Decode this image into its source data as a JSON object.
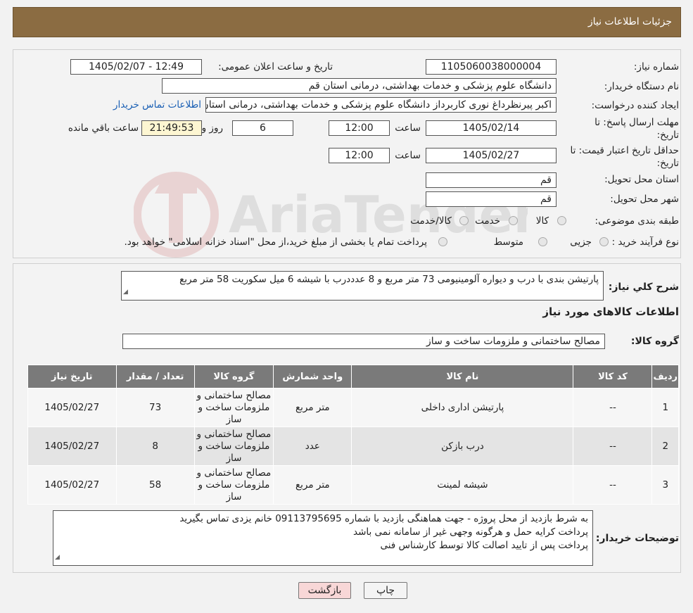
{
  "header": {
    "title": "جزئیات اطلاعات نیاز"
  },
  "form": {
    "need_number_label": "شماره نیاز:",
    "need_number": "1105060038000004",
    "announce_label": "تاریخ و ساعت اعلان عمومی:",
    "announce_value": "1405/02/07 - 12:49",
    "buyer_label": "نام دستگاه خریدار:",
    "buyer_value": "دانشگاه علوم پزشکی و خدمات بهداشتی، درمانی استان قم",
    "creator_label": "ایجاد کننده درخواست:",
    "creator_value": "اکبر پیرنظرداغ نوری کاربرداز دانشگاه علوم پزشکی و خدمات بهداشتی، درمانی استان قم",
    "contact_link": "اطلاعات تماس خریدار",
    "deadline_label_line1": "مهلت ارسال پاسخ: تا",
    "deadline_label_line2": "تاریخ:",
    "deadline_date": "1405/02/14",
    "time_label": "ساعت",
    "deadline_time": "12:00",
    "days_value": "6",
    "days_label": "روز و",
    "remaining_time": "21:49:53",
    "remaining_label": "ساعت باقي مانده",
    "validity_label_line1": "حداقل تاریخ اعتبار قیمت: تا",
    "validity_label_line2": "تاریخ:",
    "validity_date": "1405/02/27",
    "validity_time": "12:00",
    "province_label": "استان محل تحویل:",
    "province_value": "قم",
    "city_label": "شهر محل تحویل:",
    "city_value": "قم",
    "category_label": "طبقه بندی موضوعی:",
    "category_options": [
      "کالا",
      "خدمت",
      "کالا/خدمت"
    ],
    "process_label": "نوع فرآیند خرید :",
    "process_options": [
      "جزیی",
      "متوسط"
    ],
    "process_note": "پرداخت تمام یا بخشی از مبلغ خرید،از محل \"اسناد خزانه اسلامی\" خواهد بود."
  },
  "details": {
    "summary_label": "شرح کلي نياز:",
    "summary_value": "پارتیشن بندی با درب و دیواره آلومینیومی 73 متر مربع و 8 عدددرب با شیشه 6 میل سکوریت 58 متر مربع",
    "goods_info_title": "اطلاعات کالاهای مورد نیاز",
    "goods_group_label": "گروه کالا:",
    "goods_group_value": "مصالح ساختمانی و ملزومات ساخت و ساز"
  },
  "table": {
    "headers": [
      "ردیف",
      "کد کالا",
      "نام کالا",
      "واحد شمارش",
      "گروه کالا",
      "تعداد / مقدار",
      "تاریخ نیاز"
    ],
    "rows": [
      {
        "idx": "1",
        "code": "--",
        "name": "پارتیشن اداری داخلی",
        "unit": "متر مربع",
        "group": "مصالح ساختمانی و ملزومات ساخت و ساز",
        "qty": "73",
        "date": "1405/02/27"
      },
      {
        "idx": "2",
        "code": "--",
        "name": "درب بازکن",
        "unit": "عدد",
        "group": "مصالح ساختمانی و ملزومات ساخت و ساز",
        "qty": "8",
        "date": "1405/02/27"
      },
      {
        "idx": "3",
        "code": "--",
        "name": "شیشه لمینت",
        "unit": "متر مربع",
        "group": "مصالح ساختمانی و ملزومات ساخت و ساز",
        "qty": "58",
        "date": "1405/02/27"
      }
    ]
  },
  "notes": {
    "label": "توضیحات خریدار:",
    "lines": [
      "به شرط بازدید از محل پروژه - جهت هماهنگی بازدید با شماره 09113795695 خانم یزدی تماس بگیرید",
      "پرداخت کرایه حمل و هرگونه وجهی غیر از سامانه نمی باشد",
      "پرداخت پس از تایید اصالت کالا توسط کارشناس فنی"
    ]
  },
  "buttons": {
    "print": "چاپ",
    "back": "بازگشت"
  },
  "watermark": {
    "text": "AriaTender.neT"
  },
  "colors": {
    "header": "#8b6c42",
    "table_header": "#7a7a7a",
    "back_button": "#f8d7d7",
    "link": "#1a5fb4"
  }
}
